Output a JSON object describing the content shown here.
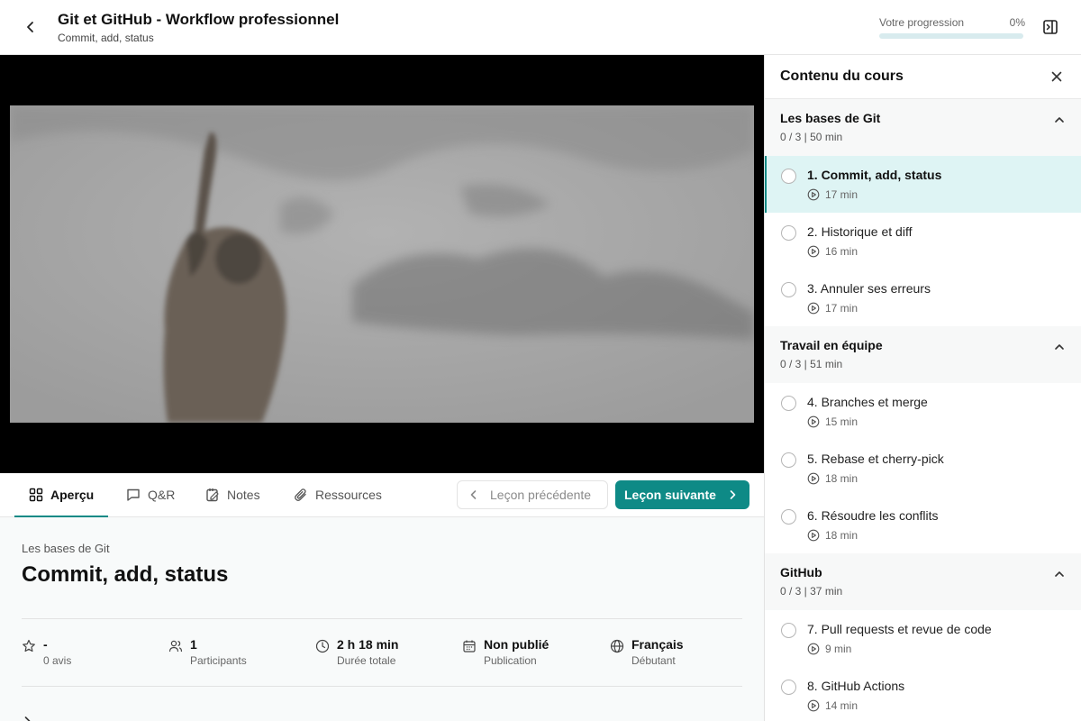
{
  "header": {
    "title": "Git et GitHub - Workflow professionnel",
    "subtitle": "Commit, add, status",
    "progress_label": "Votre progression",
    "progress_value": "0%",
    "progress_fraction": 0
  },
  "tabs": [
    {
      "label": "Aperçu",
      "icon": "grid-icon",
      "active": true
    },
    {
      "label": "Q&R",
      "icon": "chat-icon",
      "active": false
    },
    {
      "label": "Notes",
      "icon": "note-icon",
      "active": false
    },
    {
      "label": "Ressources",
      "icon": "paperclip-icon",
      "active": false
    }
  ],
  "nav": {
    "prev_label": "Leçon précédente",
    "next_label": "Leçon suivante"
  },
  "overview": {
    "section_name": "Les bases de Git",
    "lesson_title": "Commit, add, status",
    "stats": [
      {
        "icon": "star-icon",
        "value": "-",
        "label": "0 avis"
      },
      {
        "icon": "users-icon",
        "value": "1",
        "label": "Participants"
      },
      {
        "icon": "clock-icon",
        "value": "2 h 18 min",
        "label": "Durée totale"
      },
      {
        "icon": "calendar-icon",
        "value": "Non publié",
        "label": "Publication"
      },
      {
        "icon": "globe-icon",
        "value": "Français",
        "label": "Débutant"
      }
    ]
  },
  "sidebar": {
    "title": "Contenu du cours",
    "sections": [
      {
        "title": "Les bases de Git",
        "meta": "0 / 3 | 50 min",
        "items": [
          {
            "label": "1. Commit, add, status",
            "duration": "17 min",
            "current": true
          },
          {
            "label": "2. Historique et diff",
            "duration": "16 min",
            "current": false
          },
          {
            "label": "3. Annuler ses erreurs",
            "duration": "17 min",
            "current": false
          }
        ]
      },
      {
        "title": "Travail en équipe",
        "meta": "0 / 3 | 51 min",
        "items": [
          {
            "label": "4. Branches et merge",
            "duration": "15 min",
            "current": false
          },
          {
            "label": "5. Rebase et cherry-pick",
            "duration": "18 min",
            "current": false
          },
          {
            "label": "6. Résoudre les conflits",
            "duration": "18 min",
            "current": false
          }
        ]
      },
      {
        "title": "GitHub",
        "meta": "0 / 3 | 37 min",
        "items": [
          {
            "label": "7. Pull requests et revue de code",
            "duration": "9 min",
            "current": false
          },
          {
            "label": "8. GitHub Actions",
            "duration": "14 min",
            "current": false
          }
        ]
      }
    ]
  },
  "colors": {
    "accent": "#0e8a86",
    "current_row": "#def4f4",
    "progress_track": "#d8ebee"
  }
}
